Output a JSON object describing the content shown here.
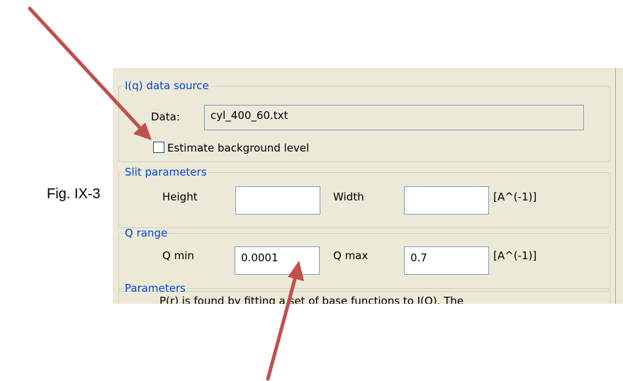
{
  "figure_label": "Fig. IX-3",
  "dialog": {
    "data_source": {
      "legend": "I(q) data source",
      "data_label": "Data:",
      "data_value": "cyl_400_60.txt",
      "estimate_bg_label": "Estimate background level",
      "estimate_bg_checked": false
    },
    "slit": {
      "legend": "Slit parameters",
      "height_label": "Height",
      "height_value": "",
      "width_label": "Width",
      "width_value": "",
      "unit": "[A^(-1)]"
    },
    "q_range": {
      "legend": "Q range",
      "qmin_label": "Q min",
      "qmin_value": "0.0001",
      "qmax_label": "Q max",
      "qmax_value": "0.7",
      "unit": "[A^(-1)]"
    },
    "parameters": {
      "legend": "Parameters",
      "description": "P(r) is found by fitting a set of base functions to I(Q). The"
    }
  },
  "colors": {
    "arrow": "#c0504d",
    "legend_text": "#0046d5",
    "dialog_bg": "#ece9d8"
  }
}
